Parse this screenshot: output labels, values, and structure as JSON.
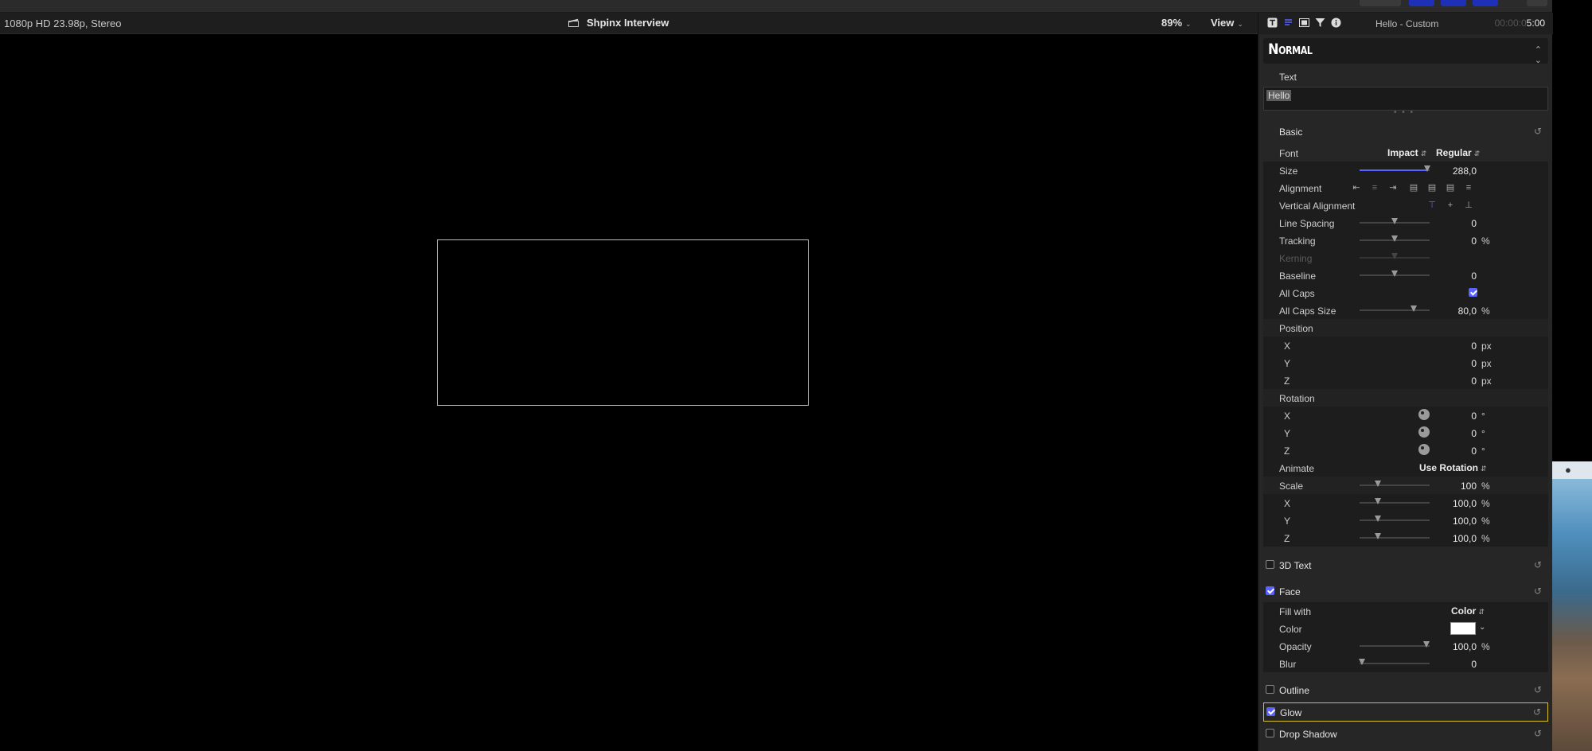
{
  "viewer": {
    "format": "1080p HD 23.98p, Stereo",
    "project": "Shpinx Interview",
    "zoom": "89%",
    "view": "View"
  },
  "inspector": {
    "title": "Hello - Custom",
    "timecode_dim": "00:00:0",
    "timecode": "5:00",
    "preset": "Normal",
    "text_label": "Text",
    "text_value": "Hello",
    "basic": {
      "title": "Basic",
      "font_label": "Font",
      "font_value": "Impact",
      "style_value": "Regular",
      "size_label": "Size",
      "size_value": "288,0",
      "size_level": 0.97,
      "alignment_label": "Alignment",
      "valign_label": "Vertical Alignment",
      "line_spacing_label": "Line Spacing",
      "line_spacing_value": "0",
      "tracking_label": "Tracking",
      "tracking_value": "0",
      "tracking_unit": "%",
      "kerning_label": "Kerning",
      "baseline_label": "Baseline",
      "baseline_value": "0",
      "all_caps_label": "All Caps",
      "all_caps_checked": true,
      "all_caps_size_label": "All Caps Size",
      "all_caps_size_value": "80,0",
      "all_caps_size_unit": "%",
      "position_label": "Position",
      "pos_x": "0",
      "pos_y": "0",
      "pos_z": "0",
      "px_unit": "px",
      "rotation_label": "Rotation",
      "rot_x": "0",
      "rot_y": "0",
      "rot_z": "0",
      "deg_unit": "°",
      "animate_label": "Animate",
      "animate_value": "Use Rotation",
      "scale_label": "Scale",
      "scale_value": "100",
      "scale_x": "100,0",
      "scale_y": "100,0",
      "scale_z": "100,0",
      "pct_unit": "%",
      "x_label": "X",
      "y_label": "Y",
      "z_label": "Z"
    },
    "text3d": {
      "title": "3D Text",
      "checked": false
    },
    "face": {
      "title": "Face",
      "checked": true,
      "fill_label": "Fill with",
      "fill_value": "Color",
      "color_label": "Color",
      "color_value": "#ffffff",
      "opacity_label": "Opacity",
      "opacity_value": "100,0",
      "opacity_unit": "%",
      "blur_label": "Blur",
      "blur_value": "0"
    },
    "outline": {
      "title": "Outline",
      "checked": false
    },
    "glow": {
      "title": "Glow",
      "checked": true
    },
    "drop_shadow": {
      "title": "Drop Shadow",
      "checked": false
    }
  },
  "colors": {
    "accent": "#5a62ff",
    "highlight_border": "#d8c02a"
  }
}
